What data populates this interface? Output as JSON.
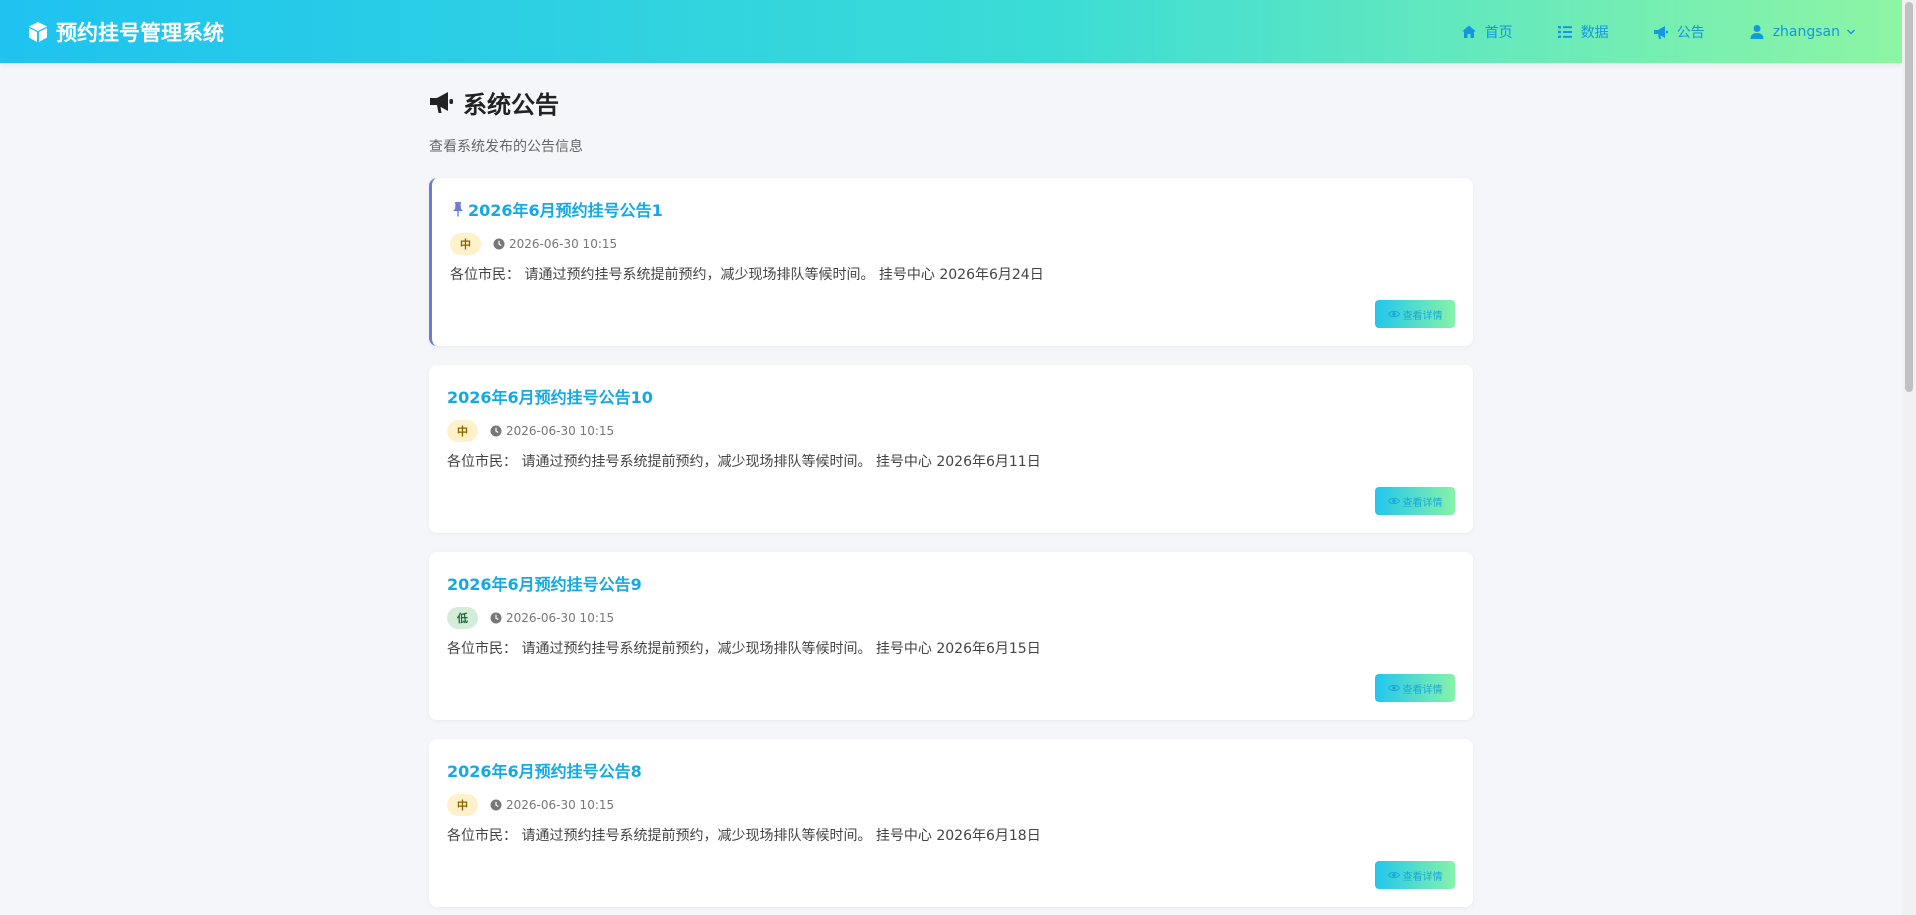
{
  "navbar": {
    "brand": "预约挂号管理系统",
    "items": [
      {
        "label": "首页",
        "icon": "home-icon"
      },
      {
        "label": "数据",
        "icon": "list-icon"
      },
      {
        "label": "公告",
        "icon": "bullhorn-icon"
      }
    ],
    "user": {
      "label": "zhangsan",
      "icon": "user-icon"
    }
  },
  "page": {
    "title": "系统公告",
    "subtitle": "查看系统发布的公告信息"
  },
  "notices": [
    {
      "title": "2026年6月预约挂号公告1",
      "pinned": true,
      "priority": "中",
      "time": "2026-06-30 10:15",
      "summary": "各位市民： 请通过预约挂号系统提前预约，减少现场排队等候时间。 挂号中心 2026年6月24日",
      "button": "查看详情"
    },
    {
      "title": "2026年6月预约挂号公告10",
      "pinned": false,
      "priority": "中",
      "time": "2026-06-30 10:15",
      "summary": "各位市民： 请通过预约挂号系统提前预约，减少现场排队等候时间。 挂号中心 2026年6月11日",
      "button": "查看详情"
    },
    {
      "title": "2026年6月预约挂号公告9",
      "pinned": false,
      "priority": "低",
      "time": "2026-06-30 10:15",
      "summary": "各位市民： 请通过预约挂号系统提前预约，减少现场排队等候时间。 挂号中心 2026年6月15日",
      "button": "查看详情"
    },
    {
      "title": "2026年6月预约挂号公告8",
      "pinned": false,
      "priority": "中",
      "time": "2026-06-30 10:15",
      "summary": "各位市民： 请通过预约挂号系统提前预约，减少现场排队等候时间。 挂号中心 2026年6月18日",
      "button": "查看详情"
    }
  ],
  "colors": {
    "accent": "#12a9e6",
    "pinned_border": "#6a7bd8",
    "badge_mid": "#fff1c9",
    "badge_low": "#d4edda"
  }
}
